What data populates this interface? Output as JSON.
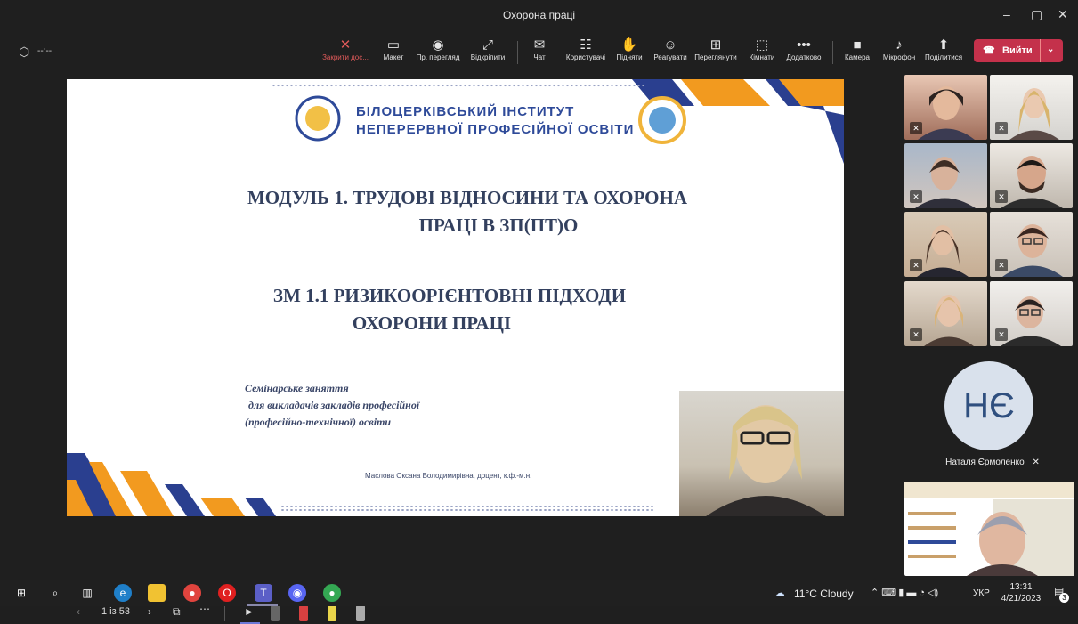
{
  "window": {
    "title": "Охорона праці"
  },
  "meeting_timer": "--:--",
  "toolbar": {
    "items": [
      {
        "label": "Закрити дос...",
        "icon": "close-share-icon",
        "glyph": "✕"
      },
      {
        "label": "Макет",
        "icon": "layout-icon",
        "glyph": "▭"
      },
      {
        "label": "Пр. перегляд",
        "icon": "preview-eye-icon",
        "glyph": "◉"
      },
      {
        "label": "Відкріпити",
        "icon": "unpin-icon",
        "glyph": "⤢"
      },
      {
        "label": "Чат",
        "icon": "chat-icon",
        "glyph": "✉"
      },
      {
        "label": "Користувачі",
        "icon": "people-icon",
        "glyph": "☷"
      },
      {
        "label": "Підняти",
        "icon": "raise-hand-icon",
        "glyph": "✋"
      },
      {
        "label": "Реагувати",
        "icon": "react-smile-icon",
        "glyph": "☺"
      },
      {
        "label": "Переглянути",
        "icon": "view-grid-icon",
        "glyph": "⊞"
      },
      {
        "label": "Кімнати",
        "icon": "rooms-icon",
        "glyph": "⬚"
      },
      {
        "label": "Додатково",
        "icon": "more-icon",
        "glyph": "•••"
      },
      {
        "label": "Камера",
        "icon": "camera-icon",
        "glyph": "■"
      },
      {
        "label": "Мікрофон",
        "icon": "microphone-icon",
        "glyph": "♪"
      },
      {
        "label": "Поділитися",
        "icon": "share-icon",
        "glyph": "⬆"
      }
    ],
    "leave_label": "Вийти"
  },
  "slide": {
    "institute_line1": "БІЛОЦЕРКІВСЬКИЙ ІНСТИТУТ",
    "institute_line2": "НЕПЕРЕРВНОЇ ПРОФЕСІЙНОЇ ОСВІТИ",
    "heading1_line1": "МОДУЛЬ 1. ТРУДОВІ ВІДНОСИНИ ТА ОХОРОНА",
    "heading1_line2": "ПРАЦІ В ЗП(ПТ)О",
    "heading2_line1": "ЗМ 1.1  РИЗИКООРІЄНТОВНІ ПІДХОДИ",
    "heading2_line2": "ОХОРОНИ ПРАЦІ",
    "seminar_line1": "Семінарське заняття",
    "seminar_line2": "для викладачів закладів професійної",
    "seminar_line3": "(професійно-технічної) освіти",
    "author": "Маслова Оксана Володимирівна, доцент, к.ф.-м.н."
  },
  "slide_nav": {
    "page": "1 із 53"
  },
  "participants": {
    "named": "Наталя Єрмоленко",
    "initials": "НЄ"
  },
  "taskbar": {
    "weather": "11°C  Cloudy",
    "lang": "УКР",
    "time": "13:31",
    "date": "4/21/2023",
    "notifications": "3"
  },
  "colors": {
    "leave": "#c4314b",
    "slide_navy": "#2e4a99",
    "slide_orange": "#f29a1f"
  }
}
